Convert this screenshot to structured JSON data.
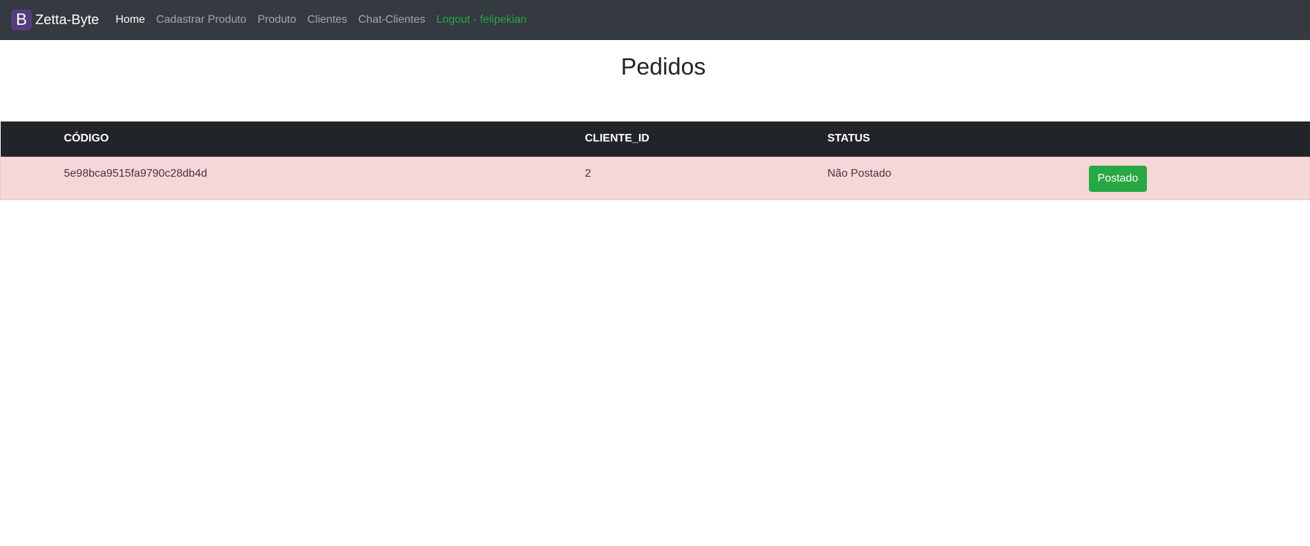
{
  "navbar": {
    "brand_logo": "B",
    "brand_name": "Zetta-Byte",
    "links": [
      {
        "label": "Home"
      },
      {
        "label": "Cadastrar Produto"
      },
      {
        "label": "Produto"
      },
      {
        "label": "Clientes"
      },
      {
        "label": "Chat-Clientes"
      },
      {
        "label": "Logout - felipekian"
      }
    ]
  },
  "page": {
    "title": "Pedidos"
  },
  "table": {
    "headers": {
      "codigo": "CÓDIGO",
      "cliente_id": "CLIENTE_ID",
      "status": "STATUS"
    },
    "rows": [
      {
        "codigo": "5e98bca9515fa9790c28db4d",
        "cliente_id": "2",
        "status": "Não Postado",
        "action_label": "Postado"
      }
    ]
  },
  "colors": {
    "navbar_bg": "#343a40",
    "header_bg": "#212529",
    "row_danger_bg": "#f5d7da",
    "success": "#28a745",
    "brand_logo_bg": "#563d7c"
  }
}
